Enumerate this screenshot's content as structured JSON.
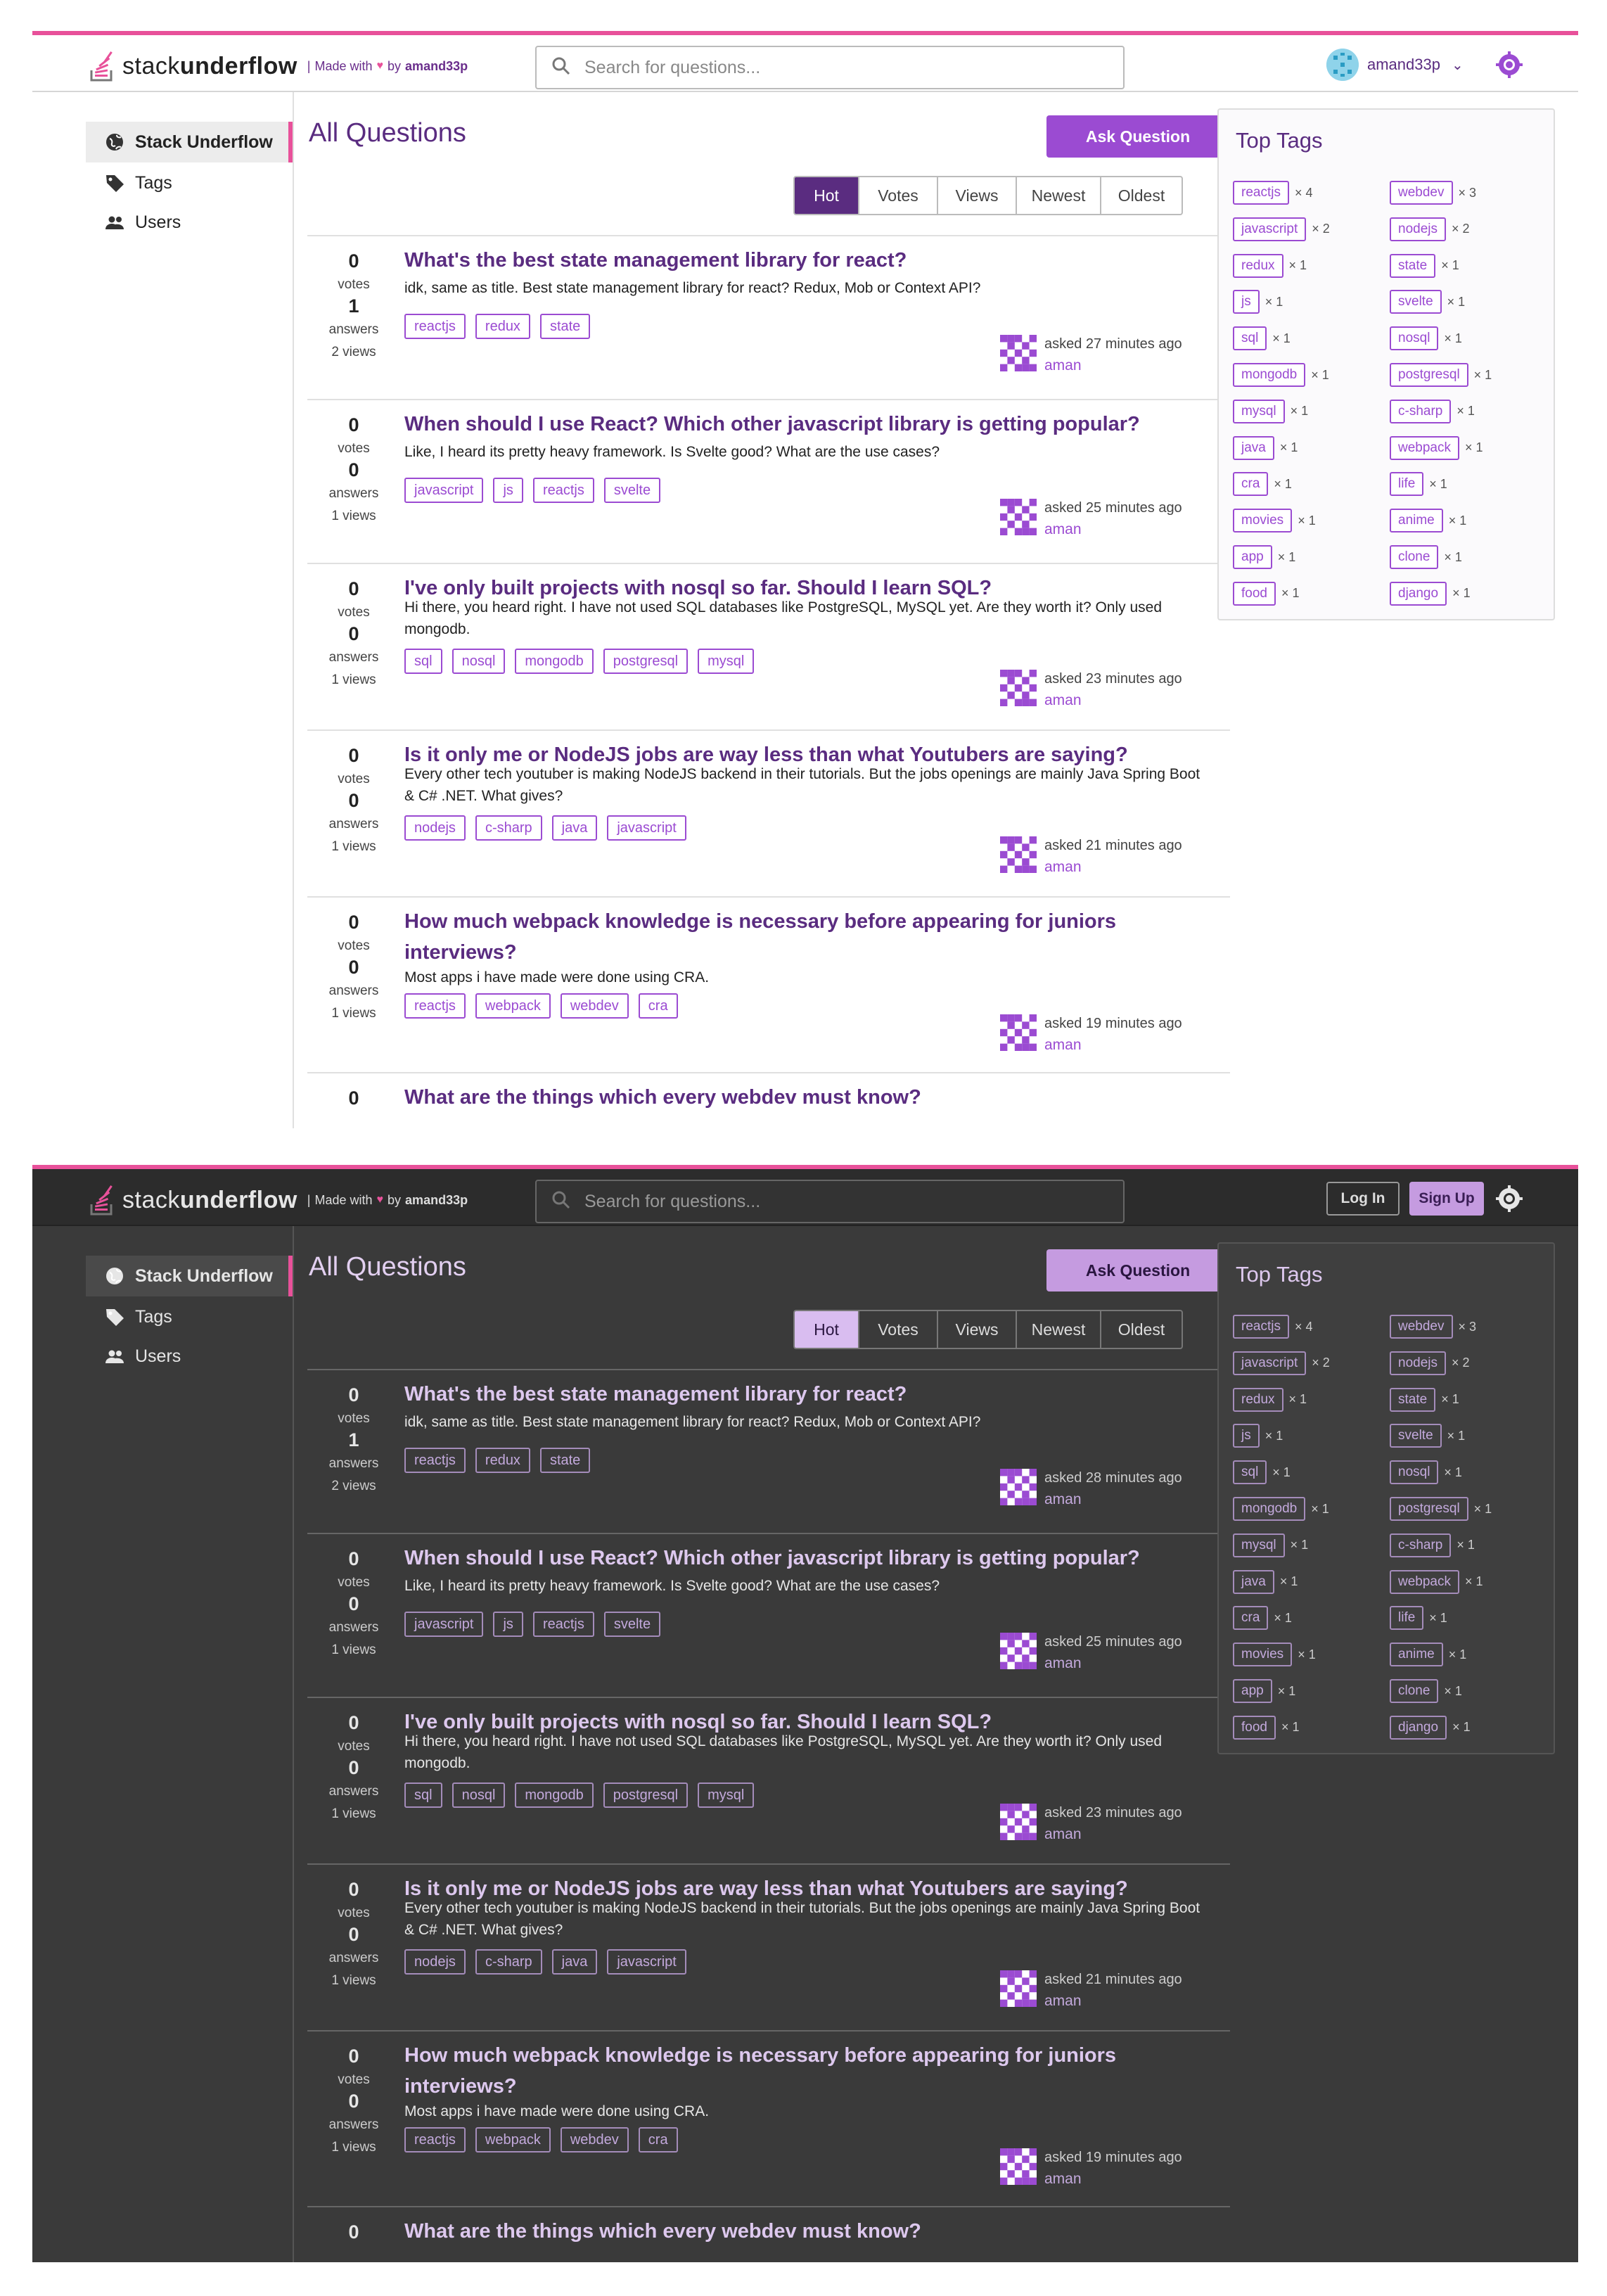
{
  "brand": {
    "name_light": "stack",
    "name_bold": "underflow",
    "made_with": "Made with",
    "by": "by",
    "author": "amand33p"
  },
  "search": {
    "placeholder": "Search for questions..."
  },
  "user": {
    "name": "amand33p"
  },
  "auth": {
    "login": "Log In",
    "signup": "Sign Up"
  },
  "sidebar": {
    "items": [
      {
        "label": "Stack Underflow",
        "icon": "globe-icon"
      },
      {
        "label": "Tags",
        "icon": "tag-icon"
      },
      {
        "label": "Users",
        "icon": "users-icon"
      }
    ]
  },
  "main": {
    "title": "All Questions",
    "ask_label": "Ask Question",
    "sort_options": [
      "Hot",
      "Votes",
      "Views",
      "Newest",
      "Oldest"
    ],
    "vote_label": "votes",
    "answer_label": "answers"
  },
  "questions": [
    {
      "votes": "0",
      "answers": "1",
      "views": "2 views",
      "title": "What's the best state management library for react?",
      "body": "idk, same as title. Best state management library for react? Redux, Mob or Context API?",
      "tags": [
        "reactjs",
        "redux",
        "state"
      ],
      "asked_light": "asked 27 minutes ago",
      "asked_dark": "asked 28 minutes ago",
      "user": "aman"
    },
    {
      "votes": "0",
      "answers": "0",
      "views": "1 views",
      "title": "When should I use React? Which other javascript library is getting popular?",
      "body": "Like, I heard its pretty heavy framework. Is Svelte good? What are the use cases?",
      "tags": [
        "javascript",
        "js",
        "reactjs",
        "svelte"
      ],
      "asked_light": "asked 25 minutes ago",
      "asked_dark": "asked 25 minutes ago",
      "user": "aman"
    },
    {
      "votes": "0",
      "answers": "0",
      "views": "1 views",
      "title": "I've only built projects with nosql so far. Should I learn SQL?",
      "body": "Hi there, you heard right. I have not used SQL databases like PostgreSQL, MySQL yet. Are they worth it? Only used mongodb.",
      "tags": [
        "sql",
        "nosql",
        "mongodb",
        "postgresql",
        "mysql"
      ],
      "asked_light": "asked 23 minutes ago",
      "asked_dark": "asked 23 minutes ago",
      "user": "aman"
    },
    {
      "votes": "0",
      "answers": "0",
      "views": "1 views",
      "title": "Is it only me or NodeJS jobs are way less than what Youtubers are saying?",
      "body": "Every other tech youtuber is making NodeJS backend in their tutorials. But the jobs openings are mainly Java Spring Boot & C# .NET. What gives?",
      "tags": [
        "nodejs",
        "c-sharp",
        "java",
        "javascript"
      ],
      "asked_light": "asked 21 minutes ago",
      "asked_dark": "asked 21 minutes ago",
      "user": "aman"
    },
    {
      "votes": "0",
      "answers": "0",
      "views": "1 views",
      "title": "How much webpack knowledge is necessary before appearing for juniors interviews?",
      "body": "Most apps i have made were done using CRA.",
      "tags": [
        "reactjs",
        "webpack",
        "webdev",
        "cra"
      ],
      "asked_light": "asked 19 minutes ago",
      "asked_dark": "asked 19 minutes ago",
      "user": "aman"
    },
    {
      "votes": "0",
      "answers": "",
      "views": "",
      "title": "What are the things which every webdev must know?",
      "body": "",
      "tags": [],
      "asked_light": "",
      "asked_dark": "",
      "user": ""
    }
  ],
  "top_tags": {
    "title": "Top Tags",
    "items": [
      {
        "name": "reactjs",
        "count": "× 4"
      },
      {
        "name": "webdev",
        "count": "× 3"
      },
      {
        "name": "javascript",
        "count": "× 2"
      },
      {
        "name": "nodejs",
        "count": "× 2"
      },
      {
        "name": "redux",
        "count": "× 1"
      },
      {
        "name": "state",
        "count": "× 1"
      },
      {
        "name": "js",
        "count": "× 1"
      },
      {
        "name": "svelte",
        "count": "× 1"
      },
      {
        "name": "sql",
        "count": "× 1"
      },
      {
        "name": "nosql",
        "count": "× 1"
      },
      {
        "name": "mongodb",
        "count": "× 1"
      },
      {
        "name": "postgresql",
        "count": "× 1"
      },
      {
        "name": "mysql",
        "count": "× 1"
      },
      {
        "name": "c-sharp",
        "count": "× 1"
      },
      {
        "name": "java",
        "count": "× 1"
      },
      {
        "name": "webpack",
        "count": "× 1"
      },
      {
        "name": "cra",
        "count": "× 1"
      },
      {
        "name": "life",
        "count": "× 1"
      },
      {
        "name": "movies",
        "count": "× 1"
      },
      {
        "name": "anime",
        "count": "× 1"
      },
      {
        "name": "app",
        "count": "× 1"
      },
      {
        "name": "clone",
        "count": "× 1"
      },
      {
        "name": "food",
        "count": "× 1"
      },
      {
        "name": "django",
        "count": "× 1"
      }
    ]
  },
  "colors": {
    "accent": "#9b4bd2",
    "brand_pink": "#e8519a",
    "title_purple": "#5a2c80",
    "dark_bg": "#3a3a3a"
  }
}
